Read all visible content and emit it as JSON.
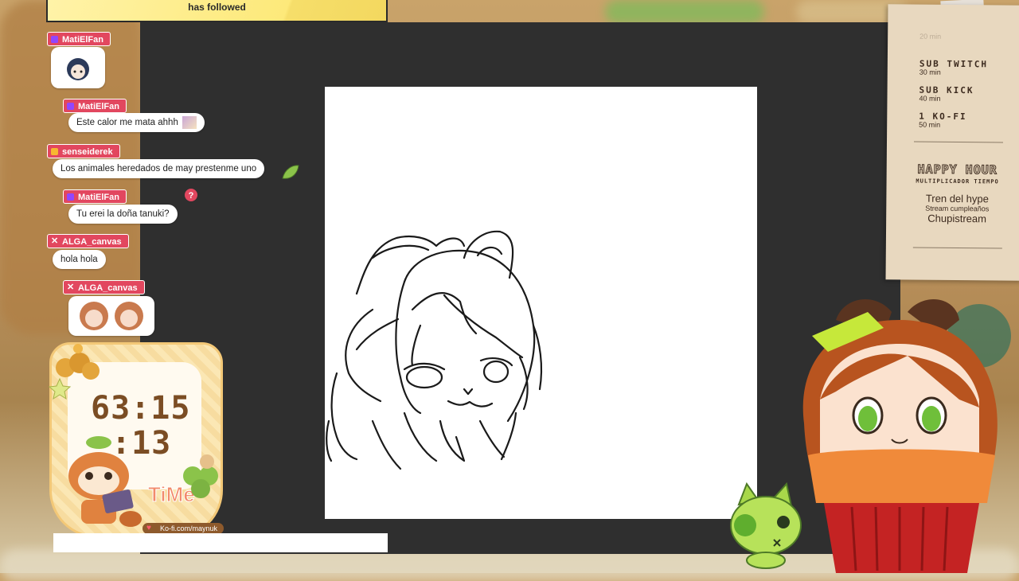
{
  "follow_banner": {
    "text": "has followed"
  },
  "chat": [
    {
      "user": "MatiElFan",
      "badge": "sub",
      "message": ""
    },
    {
      "user": "MatiElFan",
      "badge": "sub",
      "message": "Este calor me mata ahhh"
    },
    {
      "user": "senseiderek",
      "badge": "sub",
      "message": "Los animales heredados de may prestenme uno"
    },
    {
      "user": "MatiElFan",
      "badge": "sub",
      "message": "Tu erei la doña tanuki?"
    },
    {
      "user": "ALGA_canvas",
      "badge": "x",
      "message": "hola hola"
    },
    {
      "user": "ALGA_canvas",
      "badge": "x",
      "message": ""
    }
  ],
  "timer": {
    "main": "63:15",
    "seconds": ":13",
    "logo": "TiMe",
    "kofi": "Ko-fi.com/maynuk"
  },
  "schedule": {
    "items": [
      {
        "title": "SUB TWITCH",
        "time": "30 min"
      },
      {
        "title": "SUB KICK",
        "time": "40 min"
      },
      {
        "title": "1 KO-FI",
        "time": "50 min"
      }
    ],
    "faded_time": "20 min",
    "happy_hour": {
      "title": "HAPPY HOUR",
      "subtitle": "MULTIPLICADOR TIEMPO",
      "line1": "Tren del hype",
      "line2": "Stream cumpleaños",
      "line3": "Chupistream"
    }
  },
  "colors": {
    "chat_name_bg": "#e2475f",
    "stage": "#2f2f2f",
    "timer_text": "#7b4d24",
    "banner": "#fde97a"
  }
}
